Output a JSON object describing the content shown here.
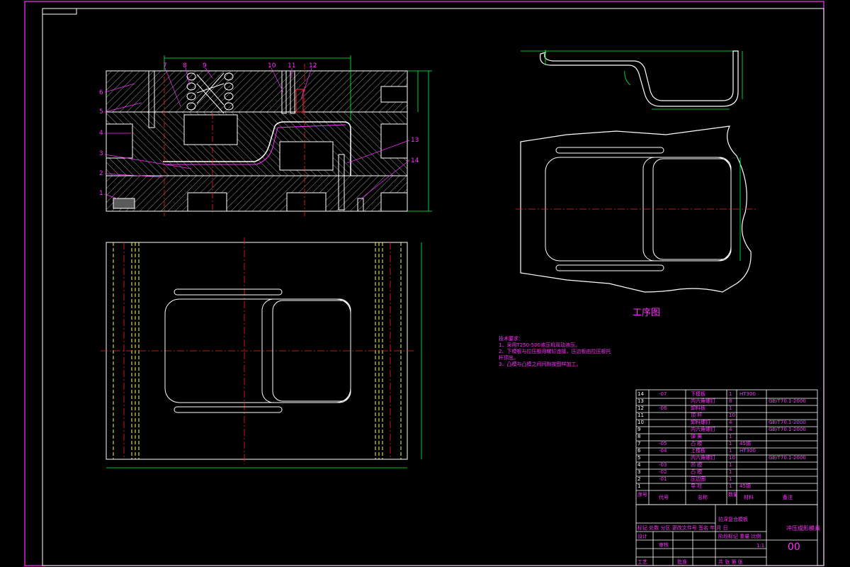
{
  "drawing": {
    "part_labels": [
      "1",
      "2",
      "3",
      "4",
      "5",
      "6",
      "7",
      "8",
      "9",
      "10",
      "11",
      "12",
      "13",
      "14"
    ],
    "stage_title": "工序图",
    "tech_requirements": [
      "技术要求：",
      "1、采用T250-500液压机双动液压。",
      "2、下模板与拉压板用螺钉连接，压边板由拉压板托",
      "   杆顶出。",
      "3、凸模与凸模之间间隙按图样加工。"
    ],
    "bom": [
      {
        "no": "14",
        "code": "-07",
        "name": "下模板",
        "qty": "1",
        "material": "HT300",
        "note": ""
      },
      {
        "no": "13",
        "code": "",
        "name": "内六角螺钉",
        "qty": "8",
        "material": "",
        "note": "GB/T70.1-2000"
      },
      {
        "no": "12",
        "code": "-06",
        "name": "卸料板",
        "qty": "1",
        "material": "",
        "note": ""
      },
      {
        "no": "11",
        "code": "",
        "name": "顶 杆",
        "qty": "10",
        "material": "",
        "note": ""
      },
      {
        "no": "10",
        "code": "",
        "name": "卸料螺钉",
        "qty": "4",
        "material": "",
        "note": "GB/T70.1-2000"
      },
      {
        "no": "9",
        "code": "",
        "name": "内六角螺钉",
        "qty": "4",
        "material": "",
        "note": "GB/T70.1-2000"
      },
      {
        "no": "8",
        "code": "",
        "name": "弹 簧",
        "qty": "1",
        "material": "",
        "note": ""
      },
      {
        "no": "7",
        "code": "-05",
        "name": "凸 模",
        "qty": "1",
        "material": "45钢",
        "note": ""
      },
      {
        "no": "6",
        "code": "-04",
        "name": "上模板",
        "qty": "1",
        "material": "HT300",
        "note": ""
      },
      {
        "no": "5",
        "code": "",
        "name": "内六角螺钉",
        "qty": "10",
        "material": "",
        "note": "GB/T70.1-2000"
      },
      {
        "no": "4",
        "code": "-03",
        "name": "凹 模",
        "qty": "1",
        "material": "",
        "note": ""
      },
      {
        "no": "3",
        "code": "-02",
        "name": "凸 模",
        "qty": "1",
        "material": "",
        "note": ""
      },
      {
        "no": "2",
        "code": "-01",
        "name": "压边圈",
        "qty": "1",
        "material": "",
        "note": ""
      },
      {
        "no": "1",
        "code": "",
        "name": "导 柱",
        "qty": "1",
        "material": "45钢",
        "note": ""
      }
    ],
    "bom_header": {
      "no": "序号",
      "code": "代号",
      "name": "名称",
      "qty": "数量",
      "material": "材料",
      "note": "备注"
    },
    "title_block": {
      "title": "拉深复合模板",
      "scale_note": "1:1",
      "company": "冲压成形模具",
      "drawing_code": "00",
      "row_labels": [
        "标记",
        "处数",
        "分区",
        "更改文件号",
        "签名",
        "年 月 日"
      ],
      "sign_labels": [
        "设计",
        "审核",
        "工艺",
        "批准"
      ],
      "stage_labels": [
        "阶段标记",
        "重量",
        "比例"
      ],
      "sheet": "共 张 第 张"
    }
  }
}
